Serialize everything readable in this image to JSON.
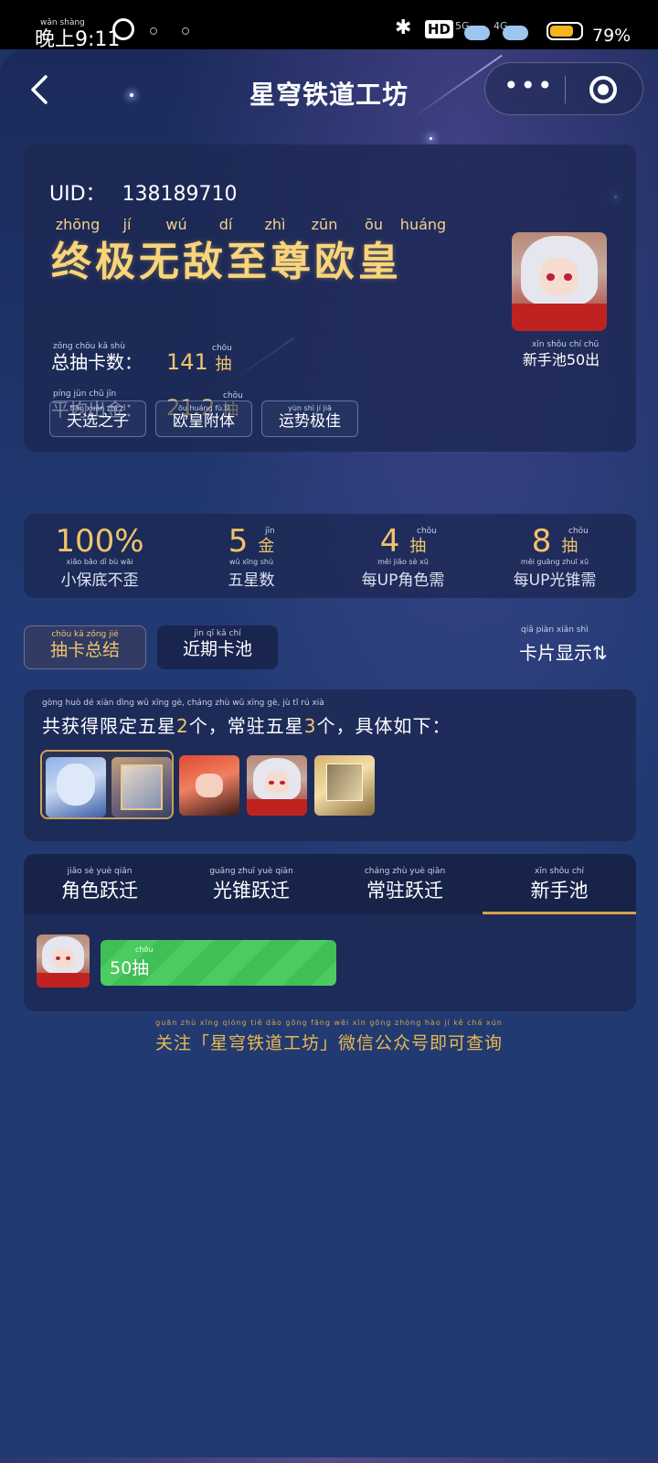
{
  "status_bar": {
    "time_ruby": "wǎn shàng",
    "time": "晚上9:11",
    "hd": "HD",
    "net1": "5G",
    "net2": "4G",
    "battery_pct": "79%",
    "battery_level": 0.79
  },
  "nav": {
    "title": "星穹铁道工坊",
    "more": "•••"
  },
  "profile": {
    "uid_label": "UID：",
    "uid": "138189710",
    "title_ruby": [
      "zhōng",
      "jí",
      "wú",
      "dí",
      "zhì",
      "zūn",
      "ōu",
      "huáng"
    ],
    "title": "终极无敌至尊欧皇",
    "total_label_ruby": "zǒng chōu kǎ shù",
    "total_label": "总抽卡数：",
    "total_value": "141",
    "total_unit_ruby": "chōu",
    "total_unit": "抽",
    "avg_label_ruby": "píng jūn chū jīn",
    "avg_label": "平均出金：",
    "avg_value": "21.2",
    "avg_unit_ruby": "chōu",
    "avg_unit": "抽",
    "tags": [
      {
        "ruby": "tiān xuǎn zhī zǐ",
        "label": "天选之子"
      },
      {
        "ruby": "ōu huáng fù tǐ",
        "label": "欧皇附体"
      },
      {
        "ruby": "yùn shì jí jiā",
        "label": "运势极佳"
      }
    ],
    "avatar_caption_ruby": "xīn shǒu chí chū",
    "avatar_caption": "新手池50出"
  },
  "summary": [
    {
      "value": "100%",
      "unit": "",
      "unit_ruby": "",
      "label_ruby": "xiǎo bǎo dǐ bù wāi",
      "label": "小保底不歪"
    },
    {
      "value": "5",
      "unit": "金",
      "unit_ruby": "jīn",
      "label_ruby": "wǔ xīng shù",
      "label": "五星数"
    },
    {
      "value": "4",
      "unit": "抽",
      "unit_ruby": "chōu",
      "label_ruby": "měi jiǎo sè xū",
      "label": "每UP角色需"
    },
    {
      "value": "8",
      "unit": "抽",
      "unit_ruby": "chōu",
      "label_ruby": "měi guāng zhuī xū",
      "label": "每UP光锥需"
    }
  ],
  "tabs": {
    "summary_ruby": "chōu kǎ zǒng jié",
    "summary": "抽卡总结",
    "recent_ruby": "jìn qī kǎ chí",
    "recent": "近期卡池",
    "display_ruby": "qiǎ piàn xiǎn shì",
    "display": "卡片显示⇅"
  },
  "fives": {
    "ruby": "gòng huò dé xiàn dìng wǔ xīng gè, cháng zhù wǔ xīng gè, jù tǐ rú xià",
    "prefix": "共获得限定五星",
    "limited": "2",
    "mid": "个，常驻五星",
    "standard": "3",
    "suffix": "个，具体如下："
  },
  "pool_tabs": [
    {
      "ruby": "jiǎo sè yuè qiān",
      "label": "角色跃迁"
    },
    {
      "ruby": "guāng zhuī yuè qiān",
      "label": "光锥跃迁"
    },
    {
      "ruby": "cháng zhù yuè qiān",
      "label": "常驻跃迁"
    },
    {
      "ruby": "xīn shǒu chí",
      "label": "新手池"
    }
  ],
  "pool_row": {
    "ruby": "chōu",
    "label": "50抽",
    "fill_fraction": 1.0
  },
  "footer": {
    "ruby": "guān zhù xīng qióng tiě dào gōng fāng wēi xìn gōng zhòng hào jí kě chá xún",
    "text": "关注「星穹铁道工坊」微信公众号即可查询"
  },
  "colors": {
    "accent_gold": "#f1c46b",
    "progress_green": "#3fbf55",
    "tab_underline": "#d8a24a"
  }
}
